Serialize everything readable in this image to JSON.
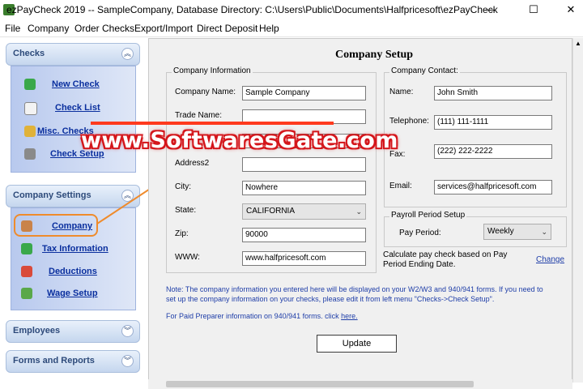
{
  "window": {
    "title": "ezPayCheck 2019 -- SampleCompany, Database Directory: C:\\Users\\Public\\Documents\\Halfpricesoft\\ezPayCheck",
    "minimize": "—",
    "maximize": "☐",
    "close": "✕"
  },
  "menu": [
    "File",
    "Company",
    "Order Checks",
    "Export/Import",
    "Direct Deposit",
    "Help"
  ],
  "sidebar": {
    "checks": {
      "title": "Checks",
      "items": [
        "New Check",
        "Check List",
        "Misc. Checks",
        "Check Setup"
      ]
    },
    "company_settings": {
      "title": "Company Settings",
      "items": [
        "Company",
        "Tax Information",
        "Deductions",
        "Wage Setup"
      ]
    },
    "employees": {
      "title": "Employees"
    },
    "forms_reports": {
      "title": "Forms and Reports"
    }
  },
  "page": {
    "title": "Company Setup"
  },
  "company_info": {
    "title": "Company Information",
    "fields": {
      "company_name": {
        "label": "Company Name:",
        "value": "Sample Company"
      },
      "trade_name": {
        "label": "Trade Name:",
        "value": ""
      },
      "address2": {
        "label": "Address2",
        "value": ""
      },
      "city": {
        "label": "City:",
        "value": "Nowhere"
      },
      "state": {
        "label": "State:",
        "value": "CALIFORNIA"
      },
      "zip": {
        "label": "Zip:",
        "value": "90000"
      },
      "www": {
        "label": "WWW:",
        "value": "www.halfpricesoft.com"
      }
    }
  },
  "company_contact": {
    "title": "Company Contact:",
    "fields": {
      "name": {
        "label": "Name:",
        "value": "John Smith"
      },
      "telephone": {
        "label": "Telephone:",
        "value": "(111) 111-1111"
      },
      "fax": {
        "label": "Fax:",
        "value": "(222) 222-2222"
      },
      "email": {
        "label": "Email:",
        "value": "services@halfpricesoft.com"
      }
    }
  },
  "payroll": {
    "title": "Payroll Period Setup",
    "label": "Pay Period:",
    "value": "Weekly",
    "calc_text": "Calculate pay check based on Pay Period Ending Date.",
    "change": "Change"
  },
  "notes": {
    "main": "Note: The company information you entered here will be displayed on your W2/W3 and 940/941 forms.  If you need to set up the company information on your checks, please edit it from left menu \"Checks->Check Setup\".",
    "preparer": "For Paid Preparer information on 940/941 forms.  click",
    "here": "here."
  },
  "update_button": "Update",
  "watermark": "www.SoftwaresGate.com",
  "colors": {
    "nav_link": "#0a2f9e",
    "note_text": "#1f3ea8",
    "callout": "#ef8b2c",
    "watermark_outline": "#d4161b"
  }
}
